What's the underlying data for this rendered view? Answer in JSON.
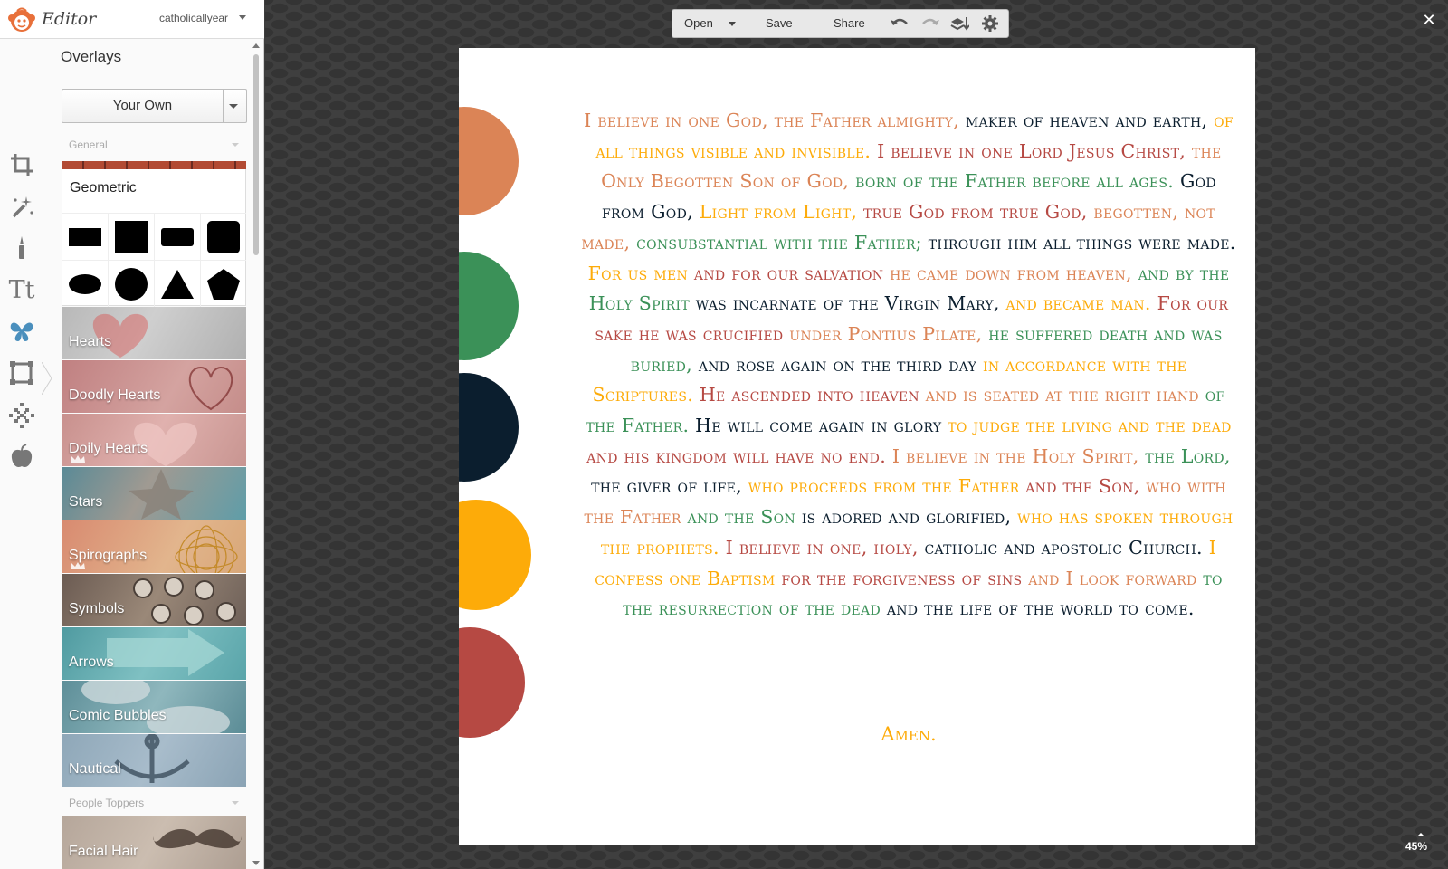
{
  "app": {
    "title": "Editor",
    "account": "catholicallyear"
  },
  "tools": [
    {
      "name": "crop-icon"
    },
    {
      "name": "magic-wand-icon"
    },
    {
      "name": "brush-icon"
    },
    {
      "name": "text-icon",
      "label": "Tt"
    },
    {
      "name": "butterfly-icon"
    },
    {
      "name": "frame-icon"
    },
    {
      "name": "texture-icon"
    },
    {
      "name": "apple-icon"
    }
  ],
  "panel": {
    "title": "Overlays",
    "select_value": "Your Own",
    "groups": [
      "General",
      "People Toppers"
    ],
    "geometric_title": "Geometric",
    "tiles": [
      {
        "label": "Hearts",
        "premium": false
      },
      {
        "label": "Doodly Hearts",
        "premium": false
      },
      {
        "label": "Doily Hearts",
        "premium": true
      },
      {
        "label": "Stars",
        "premium": false
      },
      {
        "label": "Spirographs",
        "premium": true
      },
      {
        "label": "Symbols",
        "premium": false
      },
      {
        "label": "Arrows",
        "premium": false
      },
      {
        "label": "Comic Bubbles",
        "premium": false
      },
      {
        "label": "Nautical",
        "premium": false
      }
    ],
    "tiles2": [
      {
        "label": "Facial Hair",
        "premium": false
      }
    ]
  },
  "toolbar": {
    "open": "Open",
    "save": "Save",
    "share": "Share"
  },
  "zoom": "45%",
  "colors": {
    "orange": "#db8456",
    "green": "#3b9158",
    "navy": "#0b1e2e",
    "gold": "#fdab09",
    "red": "#b64943"
  },
  "creed": {
    "segments": [
      {
        "text": "I believe in one God, the Father almighty,",
        "color": "orange"
      },
      {
        "text": " maker of heaven and earth,",
        "color": "navy"
      },
      {
        "text": " of all things visible and invisible.",
        "color": "gold"
      },
      {
        "text": " I believe in one Lord Jesus Christ,",
        "color": "red"
      },
      {
        "text": " the Only Begotten Son of God,",
        "color": "orange"
      },
      {
        "text": " born of the Father before all ages.",
        "color": "green"
      },
      {
        "text": " God from God,",
        "color": "navy"
      },
      {
        "text": " Light from Light,",
        "color": "gold"
      },
      {
        "text": " true God from true God,",
        "color": "red"
      },
      {
        "text": " begotten, not made,",
        "color": "orange"
      },
      {
        "text": " consubstantial with the Father;",
        "color": "green"
      },
      {
        "text": " through him all things were made.",
        "color": "navy"
      },
      {
        "text": " For us men",
        "color": "gold"
      },
      {
        "text": " and for our salvation",
        "color": "red"
      },
      {
        "text": " he came down from heaven,",
        "color": "orange"
      },
      {
        "text": " and by the Holy Spirit",
        "color": "green"
      },
      {
        "text": " was incarnate of the Virgin Mary,",
        "color": "navy"
      },
      {
        "text": " and became man.",
        "color": "gold"
      },
      {
        "text": " For our sake he was crucified",
        "color": "red"
      },
      {
        "text": " under Pontius Pilate,",
        "color": "orange"
      },
      {
        "text": " he suffered death and was buried,",
        "color": "green"
      },
      {
        "text": " and rose again on the third day",
        "color": "navy"
      },
      {
        "text": " in accordance with the Scriptures.",
        "color": "gold"
      },
      {
        "text": " He ascended into heaven",
        "color": "red"
      },
      {
        "text": " and is seated at the right hand",
        "color": "orange"
      },
      {
        "text": " of the Father.",
        "color": "green"
      },
      {
        "text": " He will come again in glory",
        "color": "navy"
      },
      {
        "text": " to judge the living and the dead",
        "color": "gold"
      },
      {
        "text": " and his kingdom will have no end.",
        "color": "red"
      },
      {
        "text": " I believe in the Holy Spirit,",
        "color": "orange"
      },
      {
        "text": " the Lord,",
        "color": "green"
      },
      {
        "text": " the giver of life,",
        "color": "navy"
      },
      {
        "text": " who proceeds from the Father",
        "color": "gold"
      },
      {
        "text": " and the Son,",
        "color": "red"
      },
      {
        "text": " who with the Father",
        "color": "orange"
      },
      {
        "text": " and the Son",
        "color": "green"
      },
      {
        "text": " is adored and glorified,",
        "color": "navy"
      },
      {
        "text": " who has spoken through the prophets.",
        "color": "gold"
      },
      {
        "text": " I believe in one, holy,",
        "color": "red"
      },
      {
        "text": " catholic and apostolic Church.",
        "color": "navy"
      },
      {
        "text": " I confess one Baptism",
        "color": "gold"
      },
      {
        "text": " for the forgiveness of sins",
        "color": "red"
      },
      {
        "text": " and I look forward",
        "color": "orange"
      },
      {
        "text": " to the resurrection of the dead",
        "color": "green"
      },
      {
        "text": " and the life of the world to come.",
        "color": "navy"
      }
    ],
    "amen": "Amen."
  }
}
